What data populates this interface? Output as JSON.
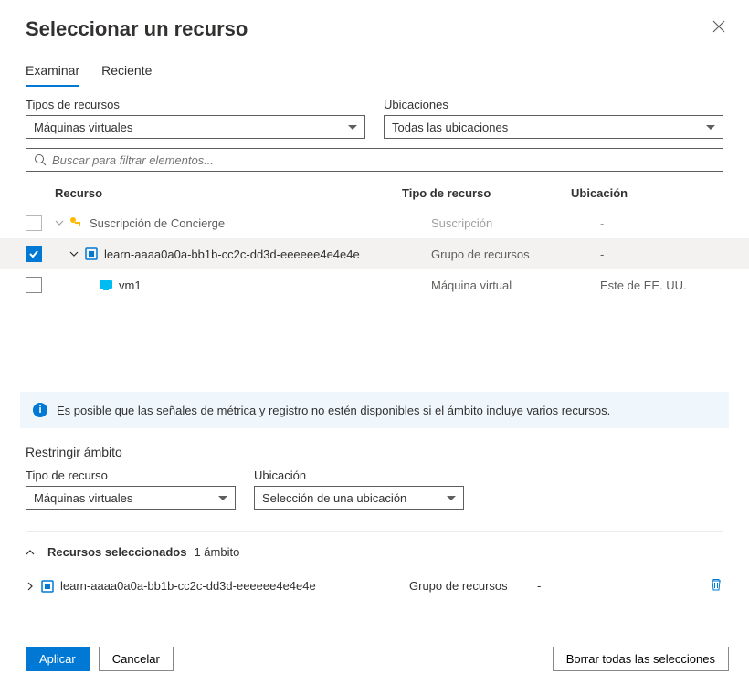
{
  "header": {
    "title": "Seleccionar un recurso"
  },
  "tabs": {
    "browse": "Examinar",
    "recent": "Reciente"
  },
  "filters": {
    "resource_types_label": "Tipos de recursos",
    "resource_types_value": "Máquinas virtuales",
    "locations_label": "Ubicaciones",
    "locations_value": "Todas las ubicaciones"
  },
  "search": {
    "placeholder": "Buscar para filtrar elementos..."
  },
  "columns": {
    "resource": "Recurso",
    "type": "Tipo de recurso",
    "location": "Ubicación"
  },
  "rows": [
    {
      "name": "Suscripción de Concierge",
      "type": "Suscripción",
      "location": "-",
      "indent": 0,
      "checked": false,
      "disabled": true,
      "icon": "key",
      "expandable": true,
      "expanded": true
    },
    {
      "name": "learn-aaaa0a0a-bb1b-cc2c-dd3d-eeeeee4e4e4e",
      "type": "Grupo de recursos",
      "location": "-",
      "indent": 1,
      "checked": true,
      "disabled": false,
      "icon": "rg",
      "expandable": true,
      "expanded": true
    },
    {
      "name": "vm1",
      "type": "Máquina virtual",
      "location": "Este de EE. UU.",
      "indent": 2,
      "checked": false,
      "disabled": false,
      "icon": "vm",
      "expandable": false,
      "expanded": false
    }
  ],
  "info_banner": "Es posible que las señales de métrica y registro no estén disponibles si el ámbito incluye varios recursos.",
  "restrict": {
    "title": "Restringir ámbito",
    "resource_type_label": "Tipo de recurso",
    "resource_type_value": "Máquinas virtuales",
    "location_label": "Ubicación",
    "location_value": "Selección de una ubicación"
  },
  "selected": {
    "heading": "Recursos seleccionados",
    "count": "1 ámbito",
    "items": [
      {
        "name": "learn-aaaa0a0a-bb1b-cc2c-dd3d-eeeeee4e4e4e",
        "type": "Grupo de recursos",
        "location": "-"
      }
    ]
  },
  "footer": {
    "apply": "Aplicar",
    "cancel": "Cancelar",
    "clear_all": "Borrar todas las selecciones"
  }
}
